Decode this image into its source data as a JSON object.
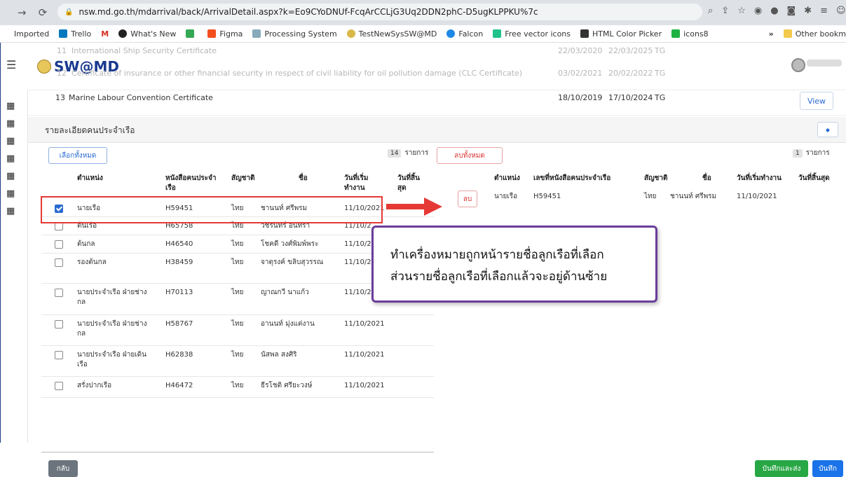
{
  "browser": {
    "url": "nsw.md.go.th/mdarrival/back/ArrivalDetail.aspx?k=Eo9CYoDNUf-FcqArCCLjG3Uq2DDN2phC-D5ugKLPPKU%7c",
    "bookmarks": [
      "Imported",
      "Trello",
      "M",
      "What's New",
      "Figma",
      "Processing System",
      "TestNewSysSW@MD",
      "Falcon",
      "Free vector icons",
      "HTML Color Picker",
      "icons8",
      "»",
      "Other bookm"
    ]
  },
  "app": {
    "logo": "SW@MD",
    "ghost_rows": [
      {
        "no": "11",
        "name": "International Ship Security Certificate",
        "issued": "22/03/2020",
        "expires": "22/03/2025",
        "by": "TG"
      },
      {
        "no": "12",
        "name": "Certificate of insurance or other financial security in respect of civil liability for oil pollution damage (CLC Certificate)",
        "issued": "03/02/2021",
        "expires": "20/02/2022",
        "by": "TG"
      }
    ],
    "cert_row": {
      "no": "13",
      "name": "Marine Labour Convention Certificate",
      "issued": "18/10/2019",
      "expires": "17/10/2024",
      "by": "TG",
      "view": "View"
    }
  },
  "section": {
    "title": "รายละเอียดคนประจำเรือ"
  },
  "left_table": {
    "select_all": "เลือกทั้งหมด",
    "count": "14",
    "count_label": "รายการ",
    "headers": [
      "ตำแหน่ง",
      "หนังสือคนประจำเรือ",
      "สัญชาติ",
      "ชื่อ",
      "วันที่เริ่มทำงาน",
      "วันที่สิ้นสุด"
    ],
    "rows": [
      {
        "checked": true,
        "position": "นายเรือ",
        "book": "H59451",
        "nation": "ไทย",
        "name": "ชานนท์ ศรีพรม",
        "start": "11/10/2021"
      },
      {
        "checked": false,
        "position": "ต้นเรือ",
        "book": "H65758",
        "nation": "ไทย",
        "name": "วัชรินทร์ อินทรา",
        "start": "11/10/2"
      },
      {
        "checked": false,
        "position": "ต้นกล",
        "book": "H46540",
        "nation": "ไทย",
        "name": "โชคดี วงศ์พิมพ์พระ",
        "start": "11/10/2"
      },
      {
        "checked": false,
        "position": "รองต้นกล",
        "book": "H38459",
        "nation": "ไทย",
        "name": "จาตุรงค์ ขลิบสุวรรณ",
        "start": "11/10/2"
      },
      {
        "checked": false,
        "position": "นายประจำเรือ ฝ่ายช่างกล",
        "book": "H70113",
        "nation": "ไทย",
        "name": "ญาณกวี นาแก้ว",
        "start": "11/10/2"
      },
      {
        "checked": false,
        "position": "นายประจำเรือ ฝ่ายช่างกล",
        "book": "H58767",
        "nation": "ไทย",
        "name": "อานนท์ มุ่งแต่งาน",
        "start": "11/10/2021"
      },
      {
        "checked": false,
        "position": "นายประจำเรือ ฝ่ายเดินเรือ",
        "book": "H62838",
        "nation": "ไทย",
        "name": "นัสพล สงศิริ",
        "start": "11/10/2021"
      },
      {
        "checked": false,
        "position": "สรั่งปากเรือ",
        "book": "H46472",
        "nation": "ไทย",
        "name": "ธีรโชติ ศรียะวงษ์",
        "start": "11/10/2021"
      }
    ]
  },
  "right_table": {
    "delete_all": "ลบทั้งหมด",
    "count": "1",
    "count_label": "รายการ",
    "headers": [
      "ตำแหน่ง",
      "เลขที่หนังสือคนประจำเรือ",
      "สัญชาติ",
      "ชื่อ",
      "วันที่เริ่มทำงาน",
      "วันที่สิ้นสุด"
    ],
    "rows": [
      {
        "delete": "ลบ",
        "position": "นายเรือ",
        "book": "H59451",
        "nation": "ไทย",
        "name": "ชานนท์ ศรีพรม",
        "start": "11/10/2021"
      }
    ]
  },
  "callout": {
    "line1": "ทำเครื่องหมายถูกหน้ารายชื่อลูกเรือที่เลือก",
    "line2": "ส่วนรายชื่อลูกเรือที่เลือกแล้วจะอยู่ด้านซ้าย"
  },
  "footer": {
    "back": "กลับ",
    "save_send": "บันทึกและส่ง",
    "save": "บันทึก"
  },
  "colors": {
    "primary": "#1a73e8",
    "success": "#28a745",
    "danger": "#e53935",
    "callout_border": "#6a3d9a"
  }
}
